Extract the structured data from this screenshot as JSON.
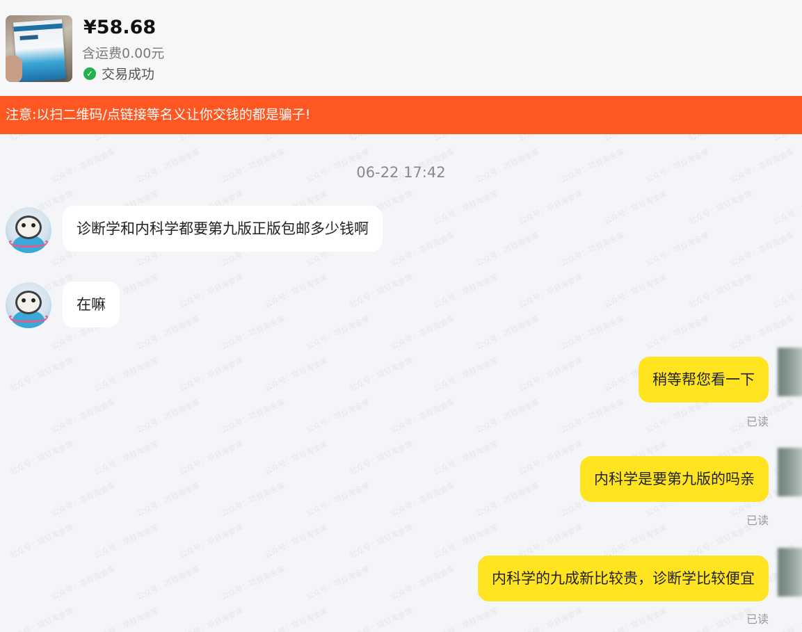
{
  "product": {
    "price": "¥58.68",
    "freight": "含运费0.00元",
    "status": "交易成功",
    "thumbnail_icon": "book-photo",
    "status_icon": "check-circle-icon"
  },
  "warning": {
    "text": "注意:以扫二维码/点链接等名义让你交钱的都是骗子!",
    "bg_color": "#ff5722"
  },
  "chat": {
    "timestamp": "06-22 17:42",
    "messages": [
      {
        "from": "buyer",
        "text": "诊断学和内科学都要第九版正版包邮多少钱啊"
      },
      {
        "from": "buyer",
        "text": "在嘛"
      },
      {
        "from": "seller",
        "text": "稍等帮您看一下",
        "status": "已读"
      },
      {
        "from": "seller",
        "text": "内科学是要第九版的吗亲",
        "status": "已读"
      },
      {
        "from": "seller",
        "text": "内科学的九成新比较贵，诊断学比较便宜",
        "status": "已读"
      }
    ]
  },
  "watermark": "公众号：项目淘金库",
  "colors": {
    "seller_bubble": "#ffe41f",
    "buyer_bubble": "#ffffff",
    "background": "#f4f5f9",
    "success": "#22b14c"
  }
}
